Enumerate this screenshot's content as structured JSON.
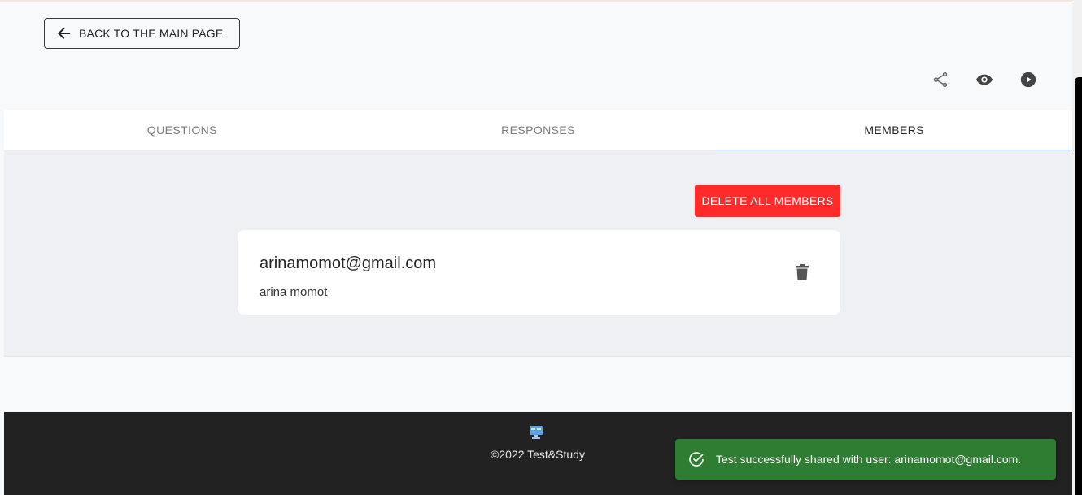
{
  "header": {
    "back_label": "BACK TO THE MAIN PAGE",
    "actions": [
      "share-icon",
      "eye-icon",
      "play-icon"
    ]
  },
  "tabs": [
    {
      "label": "QUESTIONS",
      "active": false
    },
    {
      "label": "RESPONSES",
      "active": false
    },
    {
      "label": "MEMBERS",
      "active": true
    }
  ],
  "members": {
    "delete_all_label": "DELETE ALL MEMBERS",
    "items": [
      {
        "email": "arinamomot@gmail.com",
        "name": "arina momot"
      }
    ]
  },
  "footer": {
    "copyright": "©2022 Test&Study"
  },
  "snackbar": {
    "message": "Test successfully shared with user: arinamomot@gmail.com.",
    "icon": "check-circle-icon"
  },
  "colors": {
    "accent": "#2f6fd6",
    "danger": "#ff2a2a",
    "success": "#2e7d32",
    "footer_bg": "#222222"
  }
}
